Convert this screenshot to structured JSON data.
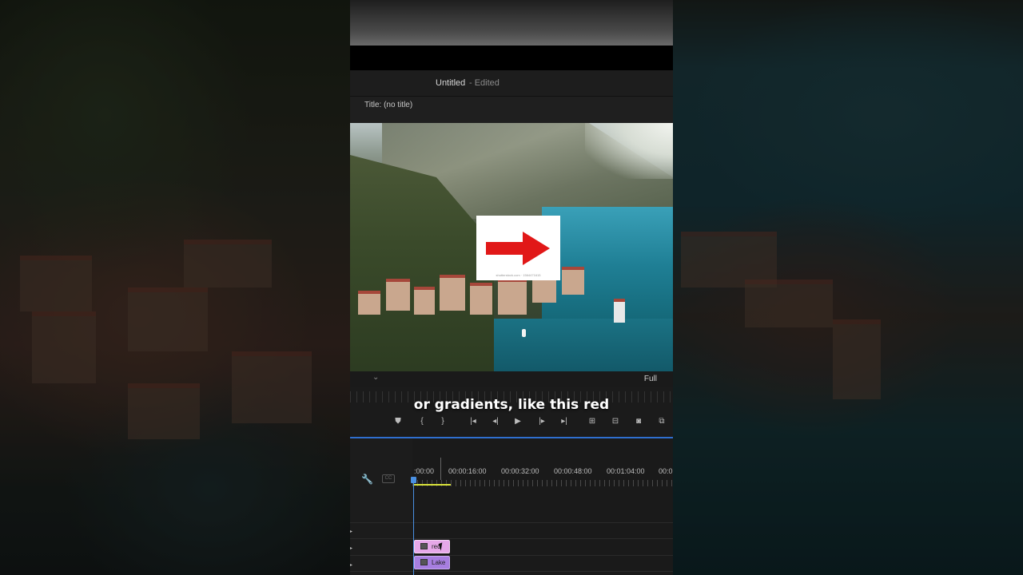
{
  "window": {
    "title": "Untitled",
    "status": "- Edited"
  },
  "program_monitor": {
    "title_label": "Title: (no title)",
    "fit": "Full",
    "overlay_credit": "shutterstock.com · 1564471615"
  },
  "caption": "or gradients, like this red",
  "transport": {
    "buttons": [
      "add-marker",
      "mark-in",
      "mark-out",
      "go-to-in",
      "step-back",
      "play",
      "step-forward",
      "go-to-out",
      "lift",
      "extract",
      "export-frame",
      "comparison-view"
    ]
  },
  "timeline": {
    "timecodes": [
      ":00:00",
      "00:00:16:00",
      "00:00:32:00",
      "00:00:48:00",
      "00:01:04:00",
      "00:0"
    ],
    "clips": [
      {
        "label": "red",
        "color": "#e6a8e9"
      },
      {
        "label": "Lake -",
        "color": "#a77ee0"
      }
    ],
    "playhead_color": "#4a90e2",
    "work_area_color": "#d8e23a"
  },
  "icons": {
    "wrench": "wrench-icon",
    "captions": "captions-icon"
  }
}
